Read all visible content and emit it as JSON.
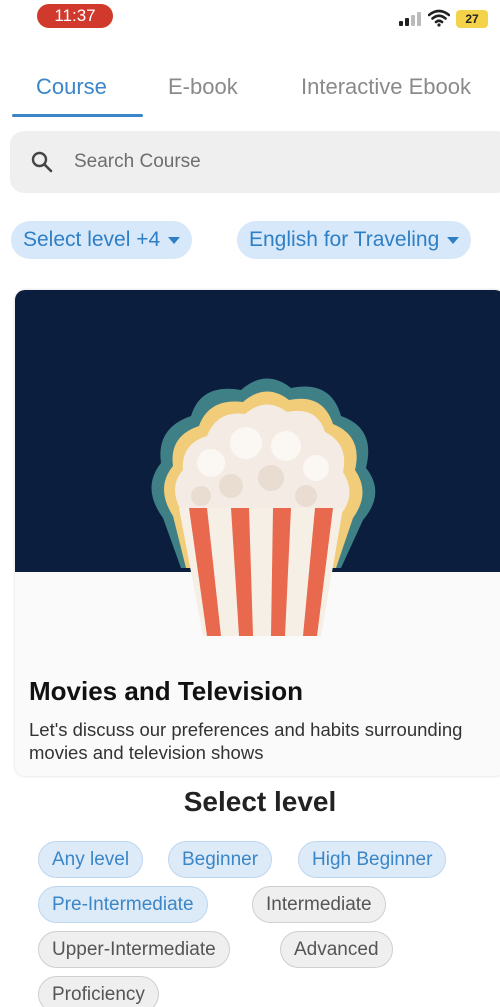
{
  "status_bar": {
    "time": "11:37",
    "battery": "27"
  },
  "tabs": [
    {
      "label": "Course",
      "active": true
    },
    {
      "label": "E-book",
      "active": false
    },
    {
      "label": "Interactive Ebook",
      "active": false
    }
  ],
  "search": {
    "placeholder": "Search Course"
  },
  "filters": [
    {
      "label": "Select level +4"
    },
    {
      "label": "English for Traveling"
    }
  ],
  "card": {
    "title": "Movies and Television",
    "description": "Let's discuss our preferences and habits surrounding movies and television shows",
    "hero_color": "#0b1e3d"
  },
  "level_sheet": {
    "title": "Select level",
    "levels": [
      {
        "label": "Any level",
        "selected": true
      },
      {
        "label": "Beginner",
        "selected": true
      },
      {
        "label": "High Beginner",
        "selected": true
      },
      {
        "label": "Pre-Intermediate",
        "selected": true
      },
      {
        "label": "Intermediate",
        "selected": false
      },
      {
        "label": "Upper-Intermediate",
        "selected": false
      },
      {
        "label": "Advanced",
        "selected": false
      },
      {
        "label": "Proficiency",
        "selected": false
      }
    ]
  },
  "colors": {
    "accent": "#3a86c8",
    "chip_bg": "#d6e8fa"
  }
}
